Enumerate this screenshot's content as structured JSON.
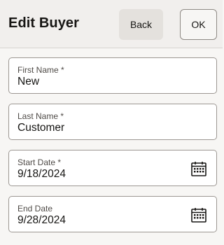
{
  "header": {
    "title": "Edit Buyer",
    "back_label": "Back",
    "ok_label": "OK"
  },
  "fields": [
    {
      "label": "First Name *",
      "value": "New"
    },
    {
      "label": "Last Name *",
      "value": "Customer"
    },
    {
      "label": "Start Date *",
      "value": "9/18/2024",
      "icon": "calendar-icon"
    },
    {
      "label": "End Date",
      "value": "9/28/2024",
      "icon": "calendar-icon"
    }
  ]
}
